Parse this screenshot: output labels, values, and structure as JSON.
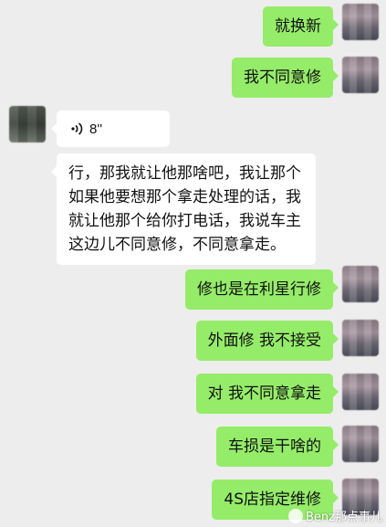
{
  "messages": [
    {
      "side": "right",
      "type": "text",
      "text": "就换新"
    },
    {
      "side": "right",
      "type": "text",
      "text": "我不同意修"
    },
    {
      "side": "left",
      "type": "voice",
      "duration": "8''"
    },
    {
      "side": "left",
      "type": "text",
      "text": "行，那我就让他那啥吧，我让那个如果他要想那个拿走处理的话，我就让他那个给你打电话，我说车主这边儿不同意修，不同意拿走。"
    },
    {
      "side": "right",
      "type": "text",
      "text": "修也是在利星行修"
    },
    {
      "side": "right",
      "type": "text",
      "text": "外面修 我不接受"
    },
    {
      "side": "right",
      "type": "text",
      "text": "对 我不同意拿走"
    },
    {
      "side": "right",
      "type": "text",
      "text": "车损是干啥的"
    },
    {
      "side": "right",
      "type": "text",
      "text": "4S店指定维修"
    }
  ],
  "watermark": {
    "text": "Benz那点事儿",
    "icon": "wechat-official-account-icon"
  },
  "colors": {
    "background": "#ededed",
    "sent_bubble": "#95ec69",
    "received_bubble": "#ffffff",
    "text": "#111111"
  }
}
